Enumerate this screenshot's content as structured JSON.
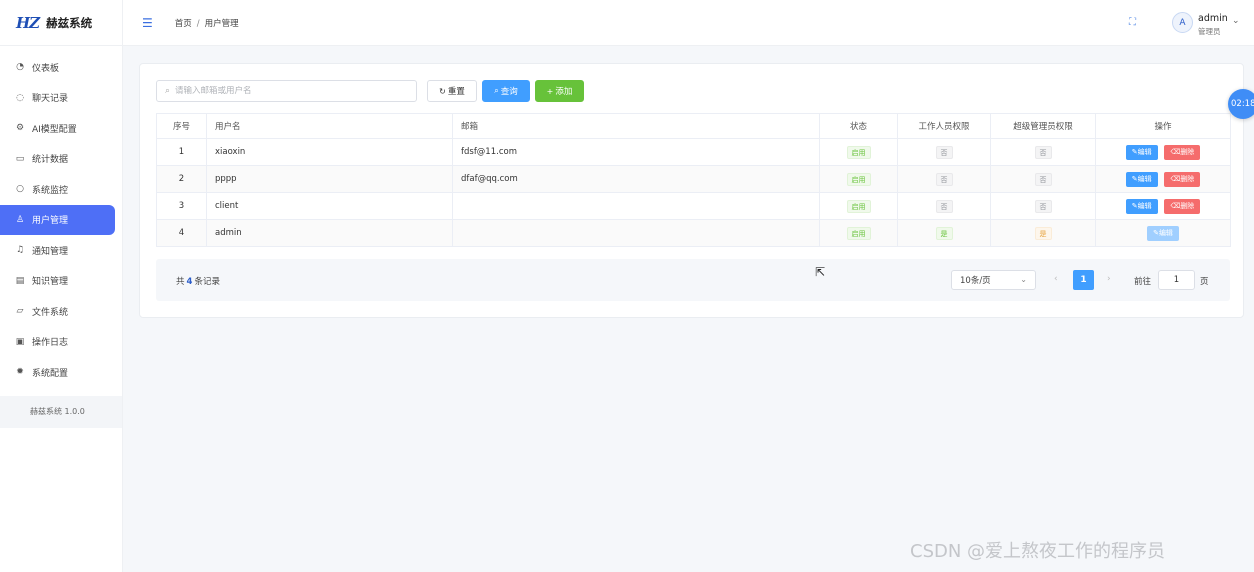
{
  "app": {
    "logo_mark": "HZ",
    "name": "赫兹系统",
    "version": "赫兹系统 1.0.0"
  },
  "sidebar": {
    "items": [
      {
        "label": "仪表板",
        "icon": "dashboard-icon"
      },
      {
        "label": "聊天记录",
        "icon": "chat-icon"
      },
      {
        "label": "AI模型配置",
        "icon": "settings-icon"
      },
      {
        "label": "统计数据",
        "icon": "chart-icon"
      },
      {
        "label": "系统监控",
        "icon": "monitor-icon"
      },
      {
        "label": "用户管理",
        "icon": "user-icon",
        "active": true
      },
      {
        "label": "通知管理",
        "icon": "bell-icon"
      },
      {
        "label": "知识管理",
        "icon": "document-icon"
      },
      {
        "label": "文件系统",
        "icon": "folder-icon"
      },
      {
        "label": "操作日志",
        "icon": "log-icon"
      },
      {
        "label": "系统配置",
        "icon": "gear-icon"
      }
    ]
  },
  "header": {
    "breadcrumb": [
      "首页",
      "用户管理"
    ],
    "user": {
      "avatar": "A",
      "name": "admin",
      "role": "管理员"
    }
  },
  "toolbar": {
    "search_placeholder": "请输入邮箱或用户名",
    "reset_label": "重置",
    "query_label": "查询",
    "add_label": "添加"
  },
  "table": {
    "headers": [
      "序号",
      "用户名",
      "邮箱",
      "状态",
      "工作人员权限",
      "超级管理员权限",
      "操作"
    ],
    "rows": [
      {
        "index": "1",
        "username": "xiaoxin",
        "email": "fdsf@11.com",
        "status": "启用",
        "staff": "否",
        "super": "否",
        "actions": [
          "编辑",
          "删除"
        ]
      },
      {
        "index": "2",
        "username": "pppp",
        "email": "dfaf@qq.com",
        "status": "启用",
        "staff": "否",
        "super": "否",
        "actions": [
          "编辑",
          "删除"
        ]
      },
      {
        "index": "3",
        "username": "client",
        "email": "",
        "status": "启用",
        "staff": "否",
        "super": "否",
        "actions": [
          "编辑",
          "删除"
        ]
      },
      {
        "index": "4",
        "username": "admin",
        "email": "",
        "status": "启用",
        "staff": "是",
        "super": "是",
        "actions": [
          "编辑"
        ]
      }
    ]
  },
  "pagination": {
    "total_prefix": "共",
    "total": "4",
    "total_suffix": "条记录",
    "page_size": "10条/页",
    "current_page": "1",
    "goto_label": "前往",
    "goto_value": "1",
    "goto_unit": "页"
  },
  "timer": "02:18",
  "watermark": "CSDN @爱上熬夜工作的程序员",
  "colors": {
    "primary": "#409eff",
    "success": "#67c23a",
    "danger": "#f56c6c",
    "active_menu": "#4e6ff6"
  }
}
